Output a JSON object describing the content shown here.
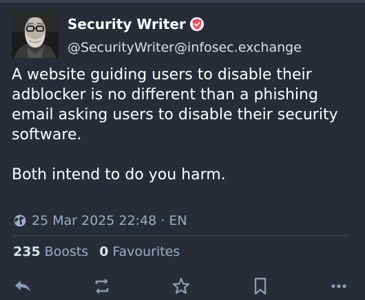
{
  "account": {
    "display_name": "Security Writer",
    "handle": "@SecurityWriter@infosec.exchange",
    "badge_icon": "verified-shield-icon",
    "badge_color": "#e84a5f"
  },
  "status": {
    "paragraphs": [
      "A website guiding users to disable their adblocker is no different than a phishing email asking users to disable their security software.",
      "Both intend to do you harm."
    ],
    "visibility_icon": "globe-icon",
    "timestamp": "25 Mar 2025 22:48",
    "separator": "·",
    "language": "EN"
  },
  "stats": {
    "boosts_count": "235",
    "boosts_label": "Boosts",
    "favourites_count": "0",
    "favourites_label": "Favourites"
  },
  "actions": [
    {
      "name": "reply",
      "icon": "reply-icon"
    },
    {
      "name": "boost",
      "icon": "boost-icon"
    },
    {
      "name": "favourite",
      "icon": "star-icon"
    },
    {
      "name": "bookmark",
      "icon": "bookmark-icon"
    },
    {
      "name": "more",
      "icon": "more-icon"
    }
  ],
  "colors": {
    "background": "#282c37",
    "text_primary": "#ffffff",
    "text_secondary": "#9baec8",
    "icon": "#8c9bb5"
  }
}
